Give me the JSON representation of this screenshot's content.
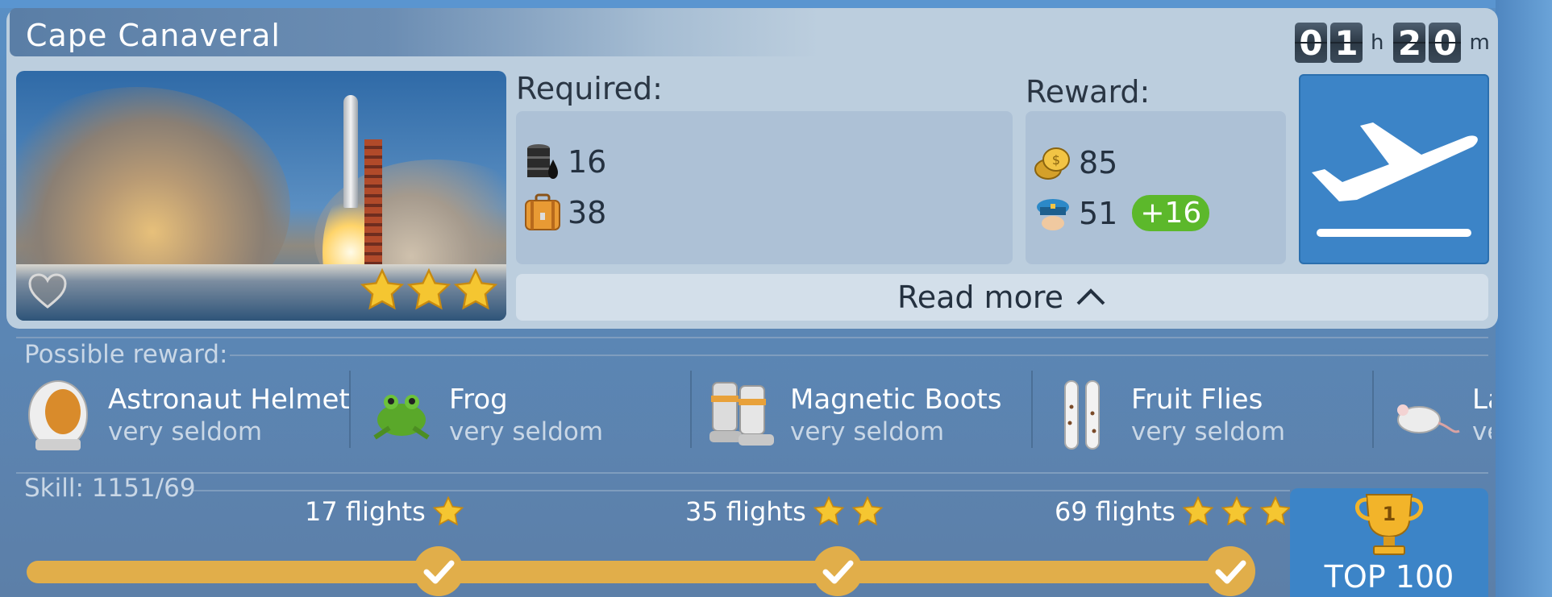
{
  "mission": {
    "title": "Cape Canaveral",
    "timer": {
      "hours": [
        "0",
        "1"
      ],
      "hours_unit": "h",
      "minutes": [
        "2",
        "0"
      ],
      "minutes_unit": "m"
    },
    "stars": 3,
    "favorite": false
  },
  "required": {
    "label": "Required:",
    "items": [
      {
        "icon": "oil-barrel-icon",
        "value": "16"
      },
      {
        "icon": "suitcase-icon",
        "value": "38"
      }
    ]
  },
  "reward": {
    "label": "Reward:",
    "items": [
      {
        "icon": "coins-icon",
        "value": "85"
      },
      {
        "icon": "pilot-cap-icon",
        "value": "51",
        "bonus": "+16"
      }
    ]
  },
  "read_more": {
    "label": "Read more"
  },
  "possible_reward": {
    "label": "Possible reward:",
    "items": [
      {
        "name": "Astronaut Helmet",
        "frequency": "very seldom",
        "icon": "astronaut-helmet-icon"
      },
      {
        "name": "Frog",
        "frequency": "very seldom",
        "icon": "frog-icon"
      },
      {
        "name": "Magnetic Boots",
        "frequency": "very seldom",
        "icon": "magnetic-boots-icon"
      },
      {
        "name": "Fruit Flies",
        "frequency": "very seldom",
        "icon": "fruit-flies-icon"
      },
      {
        "name": "La",
        "frequency": "ve",
        "icon": "lab-mouse-icon"
      }
    ]
  },
  "skill": {
    "label": "Skill: 1151/69",
    "milestones": [
      {
        "label": "17 flights",
        "stars": 1,
        "done": true
      },
      {
        "label": "35 flights",
        "stars": 2,
        "done": true
      },
      {
        "label": "69 flights",
        "stars": 3,
        "done": true
      }
    ],
    "progress": 1.0
  },
  "top100": {
    "label": "TOP 100",
    "rank_badge": "1"
  },
  "colors": {
    "accent_blue": "#3c84c7",
    "gold": "#e1ae4a",
    "green": "#5cb82b"
  }
}
